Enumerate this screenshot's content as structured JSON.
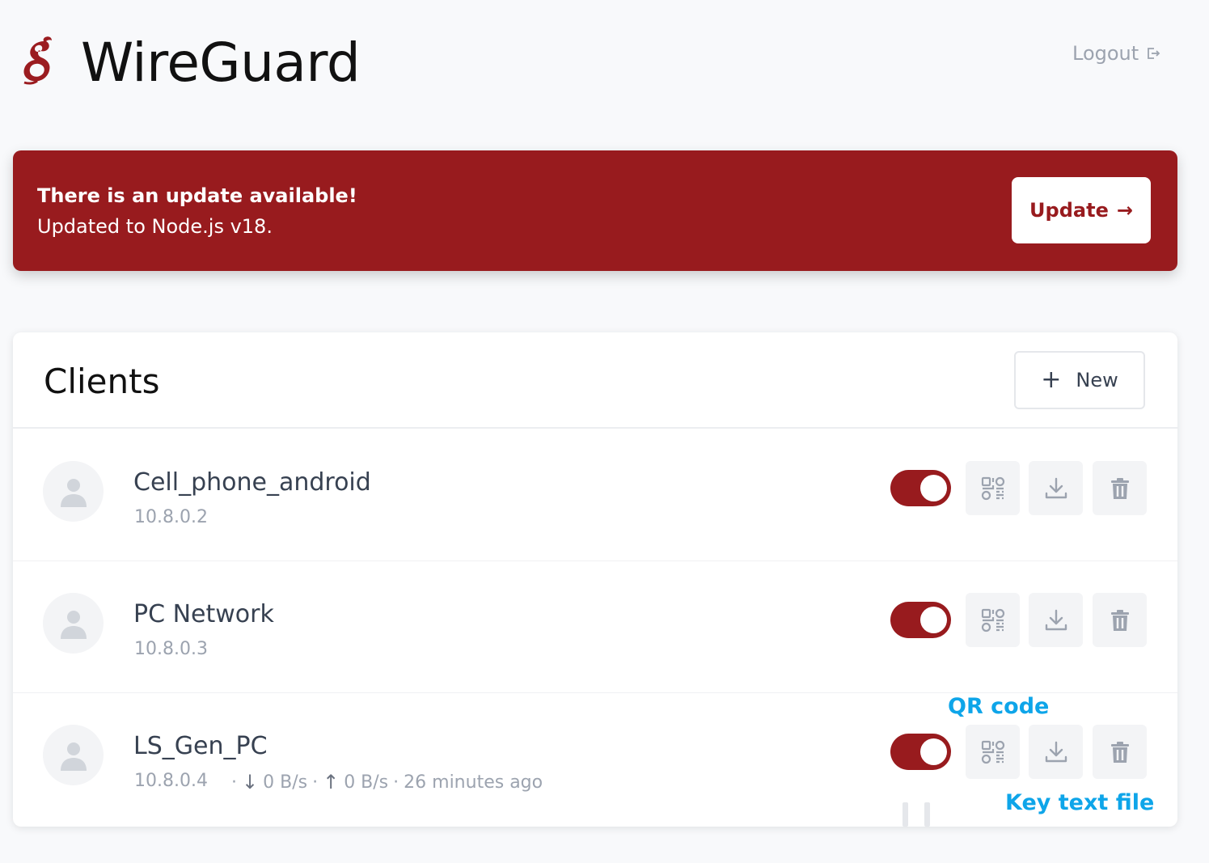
{
  "header": {
    "app_title": "WireGuard",
    "logout_label": "Logout",
    "logo_icon": "wireguard-dragon-logo"
  },
  "banner": {
    "title": "There is an update available!",
    "message": "Updated to Node.js v18.",
    "button_label": "Update",
    "button_arrow": "→",
    "color": "#981b1e"
  },
  "clients": {
    "title": "Clients",
    "new_label": "New",
    "new_icon": "+",
    "items": [
      {
        "name": "Cell_phone_android",
        "address": "10.8.0.2",
        "enabled": true,
        "stats": null
      },
      {
        "name": "PC Network",
        "address": "10.8.0.3",
        "enabled": true,
        "stats": null
      },
      {
        "name": "LS_Gen_PC",
        "address": "10.8.0.4",
        "enabled": true,
        "stats": {
          "sep": "·",
          "down_arrow": "↓",
          "download": "0 B/s",
          "up_arrow": "↑",
          "upload": "0 B/s",
          "last_seen": "26 minutes ago"
        }
      }
    ]
  },
  "annotations": {
    "qr_code": "QR code",
    "key_file": "Key text file",
    "color": "#0ea5e9"
  }
}
